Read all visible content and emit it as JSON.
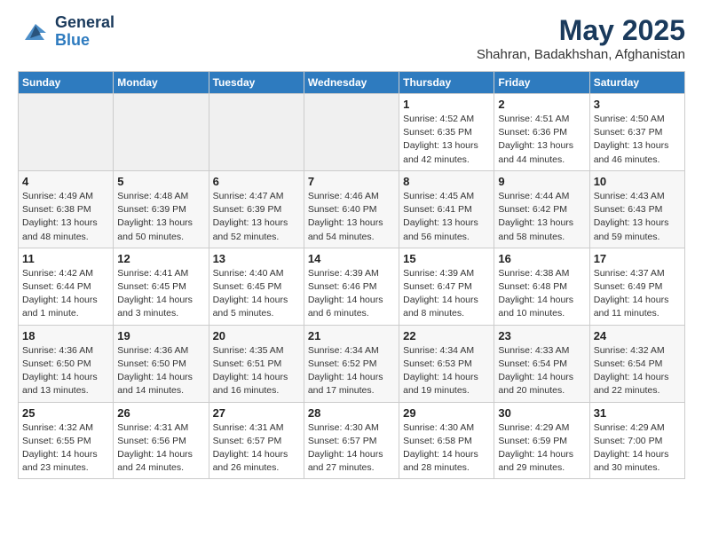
{
  "header": {
    "logo_general": "General",
    "logo_blue": "Blue",
    "month_title": "May 2025",
    "location": "Shahran, Badakhshan, Afghanistan"
  },
  "days_of_week": [
    "Sunday",
    "Monday",
    "Tuesday",
    "Wednesday",
    "Thursday",
    "Friday",
    "Saturday"
  ],
  "weeks": [
    [
      {
        "day": "",
        "info": ""
      },
      {
        "day": "",
        "info": ""
      },
      {
        "day": "",
        "info": ""
      },
      {
        "day": "",
        "info": ""
      },
      {
        "day": "1",
        "info": "Sunrise: 4:52 AM\nSunset: 6:35 PM\nDaylight: 13 hours\nand 42 minutes."
      },
      {
        "day": "2",
        "info": "Sunrise: 4:51 AM\nSunset: 6:36 PM\nDaylight: 13 hours\nand 44 minutes."
      },
      {
        "day": "3",
        "info": "Sunrise: 4:50 AM\nSunset: 6:37 PM\nDaylight: 13 hours\nand 46 minutes."
      }
    ],
    [
      {
        "day": "4",
        "info": "Sunrise: 4:49 AM\nSunset: 6:38 PM\nDaylight: 13 hours\nand 48 minutes."
      },
      {
        "day": "5",
        "info": "Sunrise: 4:48 AM\nSunset: 6:39 PM\nDaylight: 13 hours\nand 50 minutes."
      },
      {
        "day": "6",
        "info": "Sunrise: 4:47 AM\nSunset: 6:39 PM\nDaylight: 13 hours\nand 52 minutes."
      },
      {
        "day": "7",
        "info": "Sunrise: 4:46 AM\nSunset: 6:40 PM\nDaylight: 13 hours\nand 54 minutes."
      },
      {
        "day": "8",
        "info": "Sunrise: 4:45 AM\nSunset: 6:41 PM\nDaylight: 13 hours\nand 56 minutes."
      },
      {
        "day": "9",
        "info": "Sunrise: 4:44 AM\nSunset: 6:42 PM\nDaylight: 13 hours\nand 58 minutes."
      },
      {
        "day": "10",
        "info": "Sunrise: 4:43 AM\nSunset: 6:43 PM\nDaylight: 13 hours\nand 59 minutes."
      }
    ],
    [
      {
        "day": "11",
        "info": "Sunrise: 4:42 AM\nSunset: 6:44 PM\nDaylight: 14 hours\nand 1 minute."
      },
      {
        "day": "12",
        "info": "Sunrise: 4:41 AM\nSunset: 6:45 PM\nDaylight: 14 hours\nand 3 minutes."
      },
      {
        "day": "13",
        "info": "Sunrise: 4:40 AM\nSunset: 6:45 PM\nDaylight: 14 hours\nand 5 minutes."
      },
      {
        "day": "14",
        "info": "Sunrise: 4:39 AM\nSunset: 6:46 PM\nDaylight: 14 hours\nand 6 minutes."
      },
      {
        "day": "15",
        "info": "Sunrise: 4:39 AM\nSunset: 6:47 PM\nDaylight: 14 hours\nand 8 minutes."
      },
      {
        "day": "16",
        "info": "Sunrise: 4:38 AM\nSunset: 6:48 PM\nDaylight: 14 hours\nand 10 minutes."
      },
      {
        "day": "17",
        "info": "Sunrise: 4:37 AM\nSunset: 6:49 PM\nDaylight: 14 hours\nand 11 minutes."
      }
    ],
    [
      {
        "day": "18",
        "info": "Sunrise: 4:36 AM\nSunset: 6:50 PM\nDaylight: 14 hours\nand 13 minutes."
      },
      {
        "day": "19",
        "info": "Sunrise: 4:36 AM\nSunset: 6:50 PM\nDaylight: 14 hours\nand 14 minutes."
      },
      {
        "day": "20",
        "info": "Sunrise: 4:35 AM\nSunset: 6:51 PM\nDaylight: 14 hours\nand 16 minutes."
      },
      {
        "day": "21",
        "info": "Sunrise: 4:34 AM\nSunset: 6:52 PM\nDaylight: 14 hours\nand 17 minutes."
      },
      {
        "day": "22",
        "info": "Sunrise: 4:34 AM\nSunset: 6:53 PM\nDaylight: 14 hours\nand 19 minutes."
      },
      {
        "day": "23",
        "info": "Sunrise: 4:33 AM\nSunset: 6:54 PM\nDaylight: 14 hours\nand 20 minutes."
      },
      {
        "day": "24",
        "info": "Sunrise: 4:32 AM\nSunset: 6:54 PM\nDaylight: 14 hours\nand 22 minutes."
      }
    ],
    [
      {
        "day": "25",
        "info": "Sunrise: 4:32 AM\nSunset: 6:55 PM\nDaylight: 14 hours\nand 23 minutes."
      },
      {
        "day": "26",
        "info": "Sunrise: 4:31 AM\nSunset: 6:56 PM\nDaylight: 14 hours\nand 24 minutes."
      },
      {
        "day": "27",
        "info": "Sunrise: 4:31 AM\nSunset: 6:57 PM\nDaylight: 14 hours\nand 26 minutes."
      },
      {
        "day": "28",
        "info": "Sunrise: 4:30 AM\nSunset: 6:57 PM\nDaylight: 14 hours\nand 27 minutes."
      },
      {
        "day": "29",
        "info": "Sunrise: 4:30 AM\nSunset: 6:58 PM\nDaylight: 14 hours\nand 28 minutes."
      },
      {
        "day": "30",
        "info": "Sunrise: 4:29 AM\nSunset: 6:59 PM\nDaylight: 14 hours\nand 29 minutes."
      },
      {
        "day": "31",
        "info": "Sunrise: 4:29 AM\nSunset: 7:00 PM\nDaylight: 14 hours\nand 30 minutes."
      }
    ]
  ]
}
